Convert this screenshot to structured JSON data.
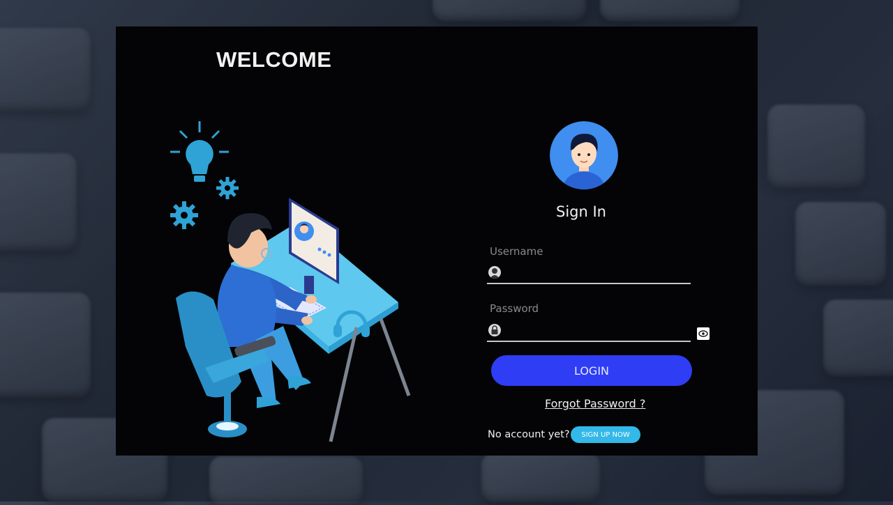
{
  "panel": {
    "welcome_title": "WELCOME"
  },
  "signin": {
    "title": "Sign In",
    "username_label": "Username",
    "username_value": "",
    "username_icon": "user-icon",
    "password_label": "Password",
    "password_value": "",
    "password_icon": "lock-icon",
    "show_password_icon": "eye-icon",
    "login_label": "LOGIN",
    "forgot_label": "Forgot Password ?",
    "no_account_text": "No account yet?",
    "signup_label": "SIGN UP NOW"
  },
  "colors": {
    "panel_bg": "#040406",
    "login_button": "#2f3df5",
    "signup_button": "#33b8e8",
    "avatar_bg": "#3f8ef0",
    "illustration_accent": "#2fa3d6"
  }
}
